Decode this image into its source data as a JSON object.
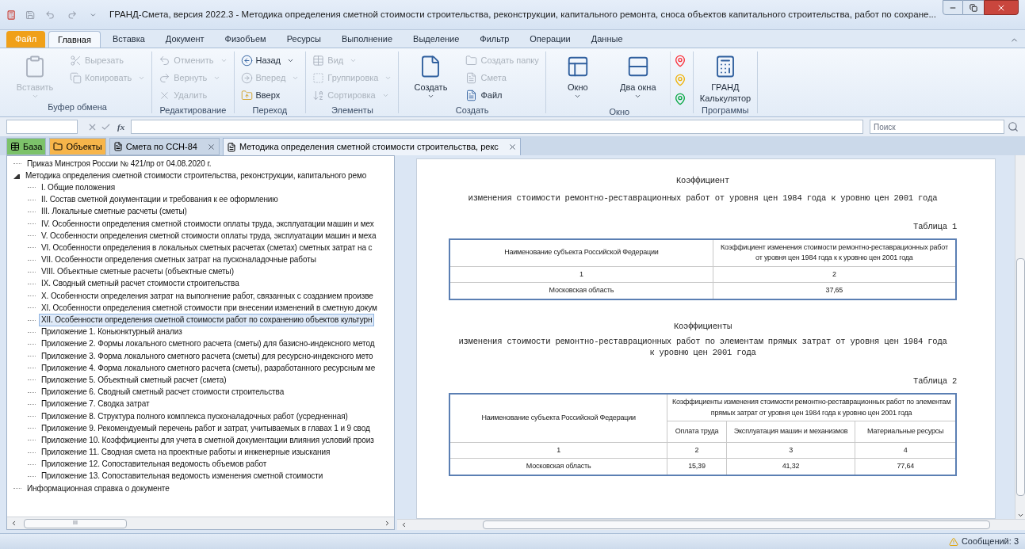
{
  "window": {
    "title": "ГРАНД-Смета, версия 2022.3 - Методика определения сметной стоимости строительства, реконструкции, капитального ремонта, сноса объектов капитального строительства, работ по сохране..."
  },
  "ribbon_tabs": [
    {
      "label": "Файл",
      "kind": "file",
      "selected": false
    },
    {
      "label": "Главная",
      "kind": "tab",
      "selected": true
    },
    {
      "label": "Вставка",
      "kind": "tab",
      "selected": false
    },
    {
      "label": "Документ",
      "kind": "tab",
      "selected": false
    },
    {
      "label": "Физобъем",
      "kind": "tab",
      "selected": false
    },
    {
      "label": "Ресурсы",
      "kind": "tab",
      "selected": false
    },
    {
      "label": "Выполнение",
      "kind": "tab",
      "selected": false
    },
    {
      "label": "Выделение",
      "kind": "tab",
      "selected": false
    },
    {
      "label": "Фильтр",
      "kind": "tab",
      "selected": false
    },
    {
      "label": "Операции",
      "kind": "tab",
      "selected": false
    },
    {
      "label": "Данные",
      "kind": "tab",
      "selected": false
    }
  ],
  "ribbon_groups": [
    {
      "label": "Буфер обмена",
      "items": [
        {
          "kind": "large",
          "label": "Вставить",
          "disabled": true,
          "dropdown": true
        },
        {
          "kind": "small",
          "label": "Вырезать",
          "disabled": true,
          "dropdown": false
        },
        {
          "kind": "small",
          "label": "Копировать",
          "disabled": true,
          "dropdown": true
        }
      ]
    },
    {
      "label": "Редактирование",
      "items": [
        {
          "kind": "small",
          "label": "Отменить",
          "disabled": true,
          "dropdown": true
        },
        {
          "kind": "small",
          "label": "Вернуть",
          "disabled": true,
          "dropdown": true
        },
        {
          "kind": "small",
          "label": "Удалить",
          "disabled": true,
          "dropdown": false
        }
      ]
    },
    {
      "label": "Переход",
      "items": [
        {
          "kind": "small",
          "label": "Назад",
          "disabled": false,
          "dropdown": true
        },
        {
          "kind": "small",
          "label": "Вперед",
          "disabled": true,
          "dropdown": true
        },
        {
          "kind": "small",
          "label": "Вверх",
          "disabled": false,
          "dropdown": false
        }
      ]
    },
    {
      "label": "Элементы",
      "items": [
        {
          "kind": "small",
          "label": "Вид",
          "disabled": true,
          "dropdown": true
        },
        {
          "kind": "small",
          "label": "Группировка",
          "disabled": true,
          "dropdown": true
        },
        {
          "kind": "small",
          "label": "Сортировка",
          "disabled": true,
          "dropdown": true
        }
      ]
    },
    {
      "label": "Создать",
      "items": [
        {
          "kind": "large",
          "label": "Создать",
          "disabled": false,
          "dropdown": true
        },
        {
          "kind": "small",
          "label": "Создать папку",
          "disabled": true,
          "dropdown": false
        },
        {
          "kind": "small",
          "label": "Смета",
          "disabled": true,
          "dropdown": false
        },
        {
          "kind": "small",
          "label": "Файл",
          "disabled": false,
          "dropdown": false
        }
      ]
    },
    {
      "label": "Окно",
      "items": [
        {
          "kind": "large",
          "label": "Окно",
          "disabled": false,
          "dropdown": true
        },
        {
          "kind": "large",
          "label": "Два окна",
          "disabled": false,
          "dropdown": true
        }
      ]
    },
    {
      "label": "Программы",
      "items": [
        {
          "kind": "large",
          "label": "ГРАНД Калькулятор",
          "disabled": false,
          "dropdown": false
        }
      ]
    }
  ],
  "formula_bar": {
    "fx": "fx"
  },
  "search": {
    "placeholder": "Поиск"
  },
  "doc_tabs": [
    {
      "label": "База",
      "color": "#7cc26a",
      "closable": false,
      "selected": false
    },
    {
      "label": "Объекты",
      "color": "#f7b54a",
      "closable": false,
      "selected": false
    },
    {
      "label": "Смета по ССН-84",
      "color": "#c9d6e6",
      "closable": true,
      "selected": false
    },
    {
      "label": "Методика определения сметной стоимости строительства, рекс",
      "color": "#eef3fa",
      "closable": true,
      "selected": true
    }
  ],
  "tree": [
    {
      "label": "Приказ Минстроя России № 421/пр от 04.08.2020 г.",
      "selected": false
    },
    {
      "label": "Методика определения сметной стоимости строительства, реконструкции, капитального ремо",
      "selected": false,
      "expanded": true,
      "children": [
        {
          "label": "I. Общие положения",
          "selected": false
        },
        {
          "label": "II. Состав сметной документации и требования к ее оформлению",
          "selected": false
        },
        {
          "label": "III. Локальные сметные расчеты (сметы)",
          "selected": false
        },
        {
          "label": "IV. Особенности определения сметной стоимости оплаты труда, эксплуатации машин и мех",
          "selected": false
        },
        {
          "label": "V. Особенности определения сметной стоимости оплаты труда, эксплуатации машин и меха",
          "selected": false
        },
        {
          "label": "VI. Особенности определения в локальных сметных расчетах (сметах) сметных затрат на с",
          "selected": false
        },
        {
          "label": "VII. Особенности определения сметных затрат на пусконаладочные работы",
          "selected": false
        },
        {
          "label": "VIII. Объектные сметные расчеты (объектные сметы)",
          "selected": false
        },
        {
          "label": "IX. Сводный сметный расчет стоимости строительства",
          "selected": false
        },
        {
          "label": "X. Особенности определения затрат на выполнение работ, связанных с созданием произве",
          "selected": false
        },
        {
          "label": "XI. Особенности определения сметной стоимости при внесении изменений в сметную докум",
          "selected": false
        },
        {
          "label": "XII. Особенности определения сметной стоимости работ по сохранению объектов культурн",
          "selected": true
        },
        {
          "label": "Приложение 1. Коньюнктурный анализ",
          "selected": false
        },
        {
          "label": "Приложение 2. Формы локального сметного расчета (сметы) для базисно-индексного метод",
          "selected": false
        },
        {
          "label": "Приложение 3. Форма локального сметного расчета (сметы) для ресурсно-индексного мето",
          "selected": false
        },
        {
          "label": "Приложение 4. Форма локального сметного расчета (сметы), разработанного ресурсным ме",
          "selected": false
        },
        {
          "label": "Приложение 5. Объектный сметный расчет (смета)",
          "selected": false
        },
        {
          "label": "Приложение 6. Сводный сметный расчет стоимости строительства",
          "selected": false
        },
        {
          "label": "Приложение 7. Сводка затрат",
          "selected": false
        },
        {
          "label": "Приложение 8. Структура полного комплекса пусконаладочных работ (усредненная)",
          "selected": false
        },
        {
          "label": "Приложение 9. Рекомендуемый перечень работ и затрат, учитываемых в главах 1 и 9 свод",
          "selected": false
        },
        {
          "label": "Приложение 10. Коэффициенты для учета в сметной документации влияния условий произ",
          "selected": false
        },
        {
          "label": "Приложение 11. Сводная смета на проектные работы и инженерные изыскания",
          "selected": false
        },
        {
          "label": "Приложение 12. Сопоставительная ведомость объемов работ",
          "selected": false
        },
        {
          "label": "Приложение 13. Сопоставительная ведомость изменения сметной стоимости",
          "selected": false
        }
      ]
    },
    {
      "label": "Информационная справка о документе",
      "selected": false
    }
  ],
  "tree_scrollbar": {
    "thumb": "III"
  },
  "document": {
    "block1": {
      "heading": "Коэффициент",
      "subtitle": "изменения стоимости ремонтно-реставрационных работ от уровня цен 1984 года к уровню цен 2001 года",
      "table_label": "Таблица 1",
      "header": [
        "Наименование субъекта Российской Федерации",
        "Коэффициент изменения стоимости ремонтно-реставрационных работ от уровня цен 1984 года к к уровню цен 2001 года"
      ],
      "rows": [
        [
          "1",
          "2"
        ],
        [
          "Московская область",
          "37,65"
        ]
      ]
    },
    "block2": {
      "heading": "Коэффициенты",
      "subtitle": "изменения стоимости ремонтно-реставрационных работ по элементам прямых затрат от уровня цен 1984 года к уровню цен 2001 года",
      "table_label": "Таблица 2",
      "header": "Наименование субъекта Российской Федерации",
      "group_header": "Коэффициенты изменения стоимости ремонтно-реставрационных работ по элементам прямых затрат от уровня цен 1984 года к уровню цен 2001 года",
      "subheaders": [
        "Оплата труда",
        "Эксплуатация машин и механизмов",
        "Материальные ресурсы"
      ],
      "rows": [
        [
          "1",
          "2",
          "3",
          "4"
        ],
        [
          "Московская область",
          "15,39",
          "41,32",
          "77,64"
        ]
      ]
    }
  },
  "status_bar": {
    "messages": "Сообщений: 3"
  }
}
